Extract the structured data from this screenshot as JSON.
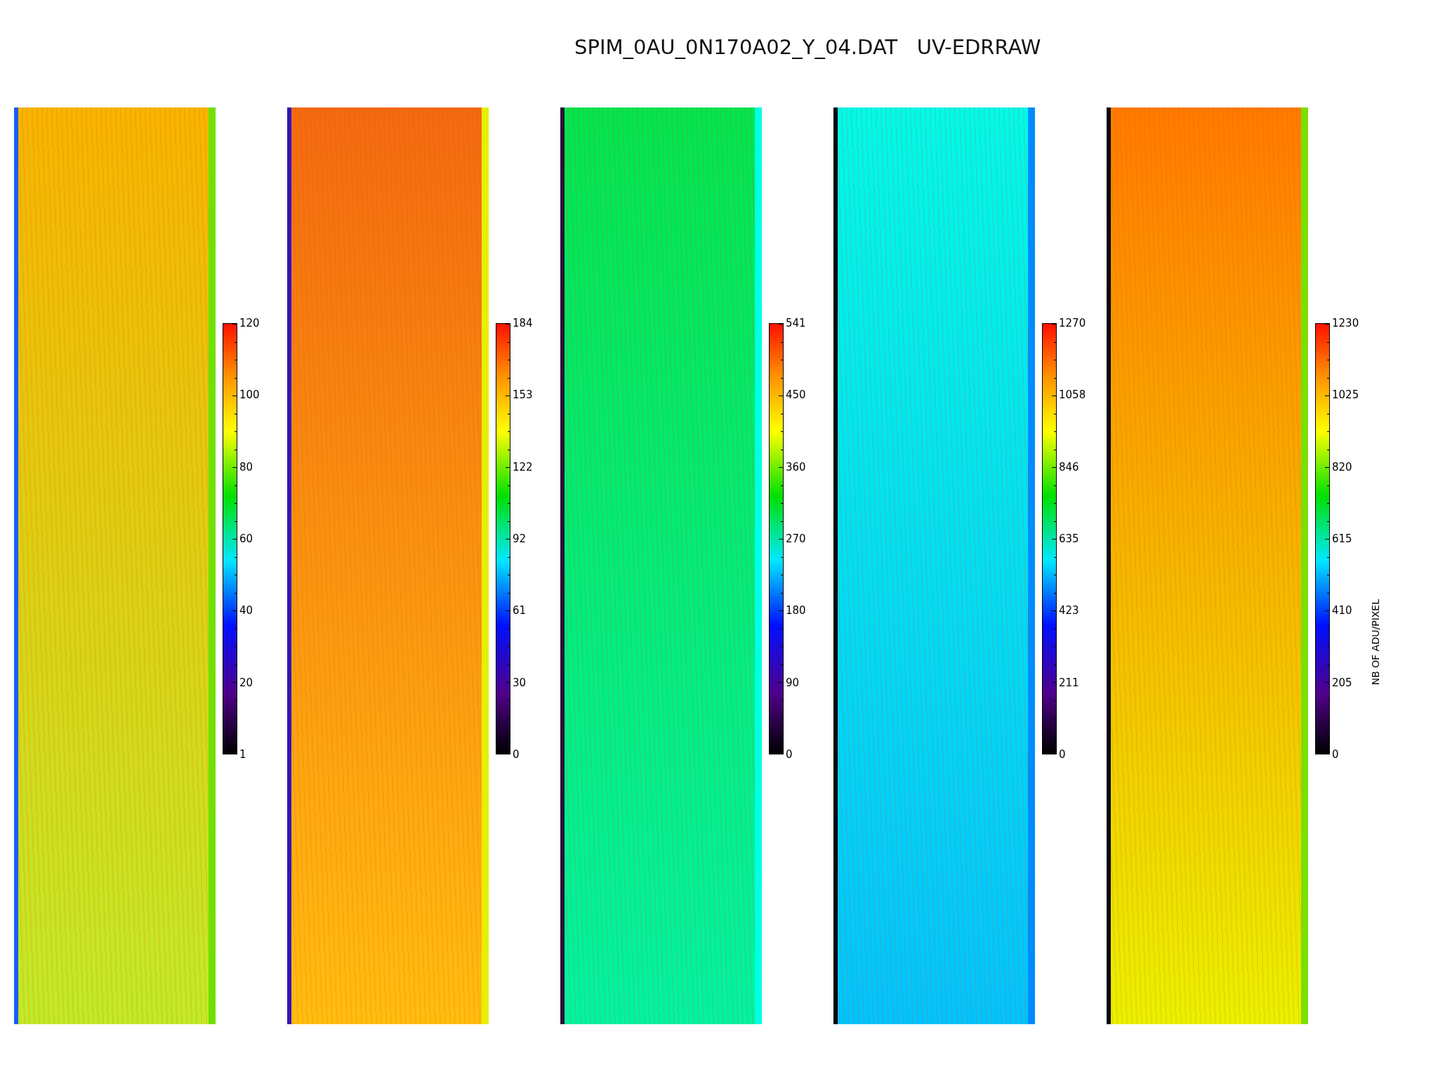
{
  "title": "SPIM_0AU_0N170A02_Y_04.DAT   UV-EDRRAW",
  "panels": [
    {
      "colorbar_labels": [
        "120",
        "100",
        "80",
        "60",
        "40",
        "20",
        "1"
      ]
    },
    {
      "colorbar_labels": [
        "184",
        "153",
        "122",
        "92",
        "61",
        "30",
        "0"
      ]
    },
    {
      "colorbar_labels": [
        "541",
        "450",
        "360",
        "270",
        "180",
        "90",
        "0"
      ]
    },
    {
      "colorbar_labels": [
        "1270",
        "1058",
        "846",
        "635",
        "423",
        "211",
        "0"
      ]
    },
    {
      "colorbar_labels": [
        "1230",
        "1025",
        "820",
        "615",
        "410",
        "205",
        "0"
      ],
      "colorbar_title": "NB OF ADU/PIXEL"
    }
  ]
}
